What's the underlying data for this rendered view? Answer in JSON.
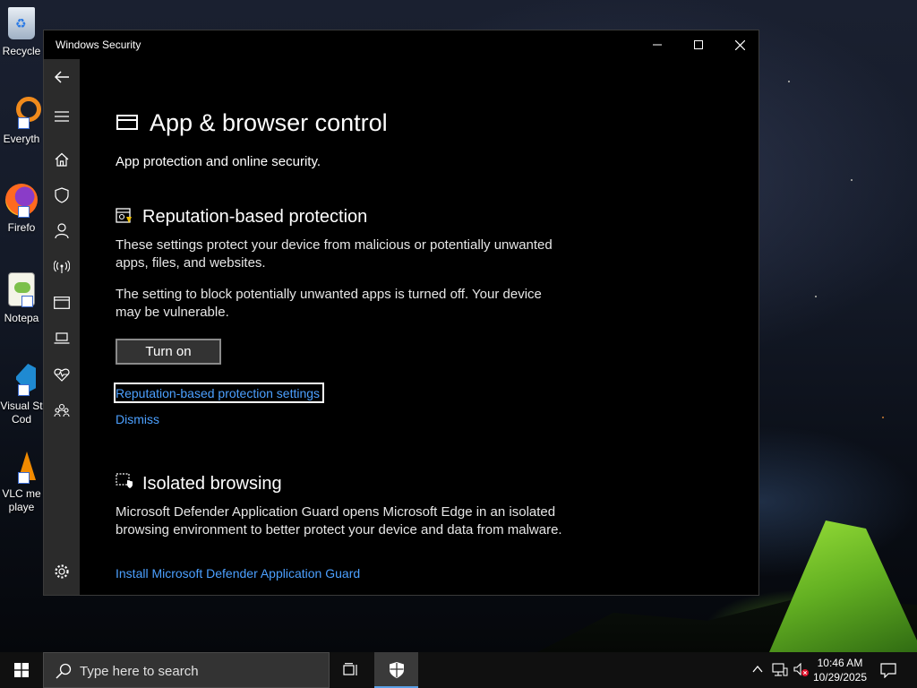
{
  "desktop": {
    "icons": [
      {
        "label": "Recycle",
        "icon": "recycle-bin-icon"
      },
      {
        "label": "Everyth",
        "icon": "everything-search-icon"
      },
      {
        "label": "Firefo",
        "icon": "firefox-icon"
      },
      {
        "label": "Notepa",
        "icon": "notepad-plus-plus-icon"
      },
      {
        "label": "Visual St",
        "label2": "Cod",
        "icon": "vscode-icon"
      },
      {
        "label": "VLC me",
        "label2": "playe",
        "icon": "vlc-icon"
      }
    ]
  },
  "window": {
    "title": "Windows Security",
    "controls": [
      "minimize",
      "maximize",
      "close"
    ]
  },
  "sidebar": {
    "items": [
      {
        "icon": "back-arrow-icon"
      },
      {
        "icon": "hamburger-menu-icon"
      },
      {
        "icon": "home-icon"
      },
      {
        "icon": "shield-icon"
      },
      {
        "icon": "person-icon"
      },
      {
        "icon": "wifi-antenna-icon"
      },
      {
        "icon": "app-browser-icon",
        "selected": true
      },
      {
        "icon": "laptop-icon"
      },
      {
        "icon": "heart-pulse-icon"
      },
      {
        "icon": "family-icon"
      },
      {
        "icon": "settings-gear-icon"
      }
    ]
  },
  "page": {
    "title": "App & browser control",
    "subtitle": "App protection and online security.",
    "reputation": {
      "heading": "Reputation-based protection",
      "description": "These settings protect your device from malicious or potentially unwanted apps, files, and websites.",
      "warning": "The setting to block potentially unwanted apps is turned off. Your device may be vulnerable.",
      "turn_on_button": "Turn on",
      "settings_link": "Reputation-based protection settings",
      "dismiss_link": "Dismiss"
    },
    "isolated": {
      "heading": "Isolated browsing",
      "description": "Microsoft Defender Application Guard opens Microsoft Edge in an isolated browsing environment to better protect your device and data from malware.",
      "install_link": "Install Microsoft Defender Application Guard"
    }
  },
  "taskbar": {
    "search_placeholder": "Type here to search",
    "time": "10:46 AM",
    "date": "10/29/2025"
  },
  "colors": {
    "link": "#4ca0ff",
    "sidebar_bg": "#2b2b2b",
    "accent": "#5aa0e6"
  }
}
